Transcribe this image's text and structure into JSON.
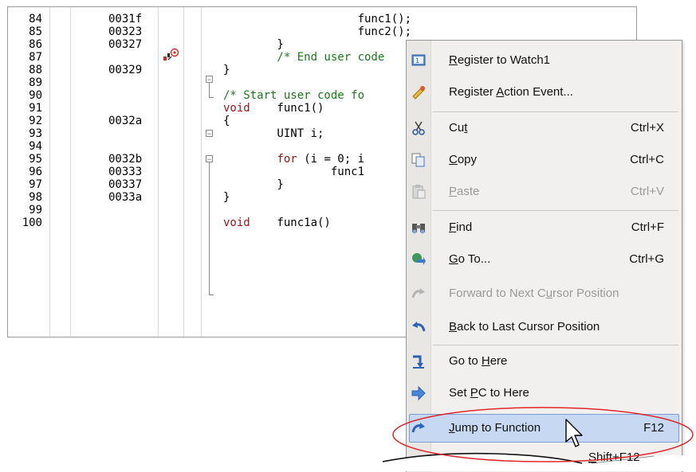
{
  "editor": {
    "lines": [
      {
        "ln": "84",
        "addr": "0031f",
        "src": [
          {
            "t": "                    func1();",
            "c": ""
          }
        ]
      },
      {
        "ln": "85",
        "addr": "00323",
        "src": [
          {
            "t": "                    func2();",
            "c": ""
          }
        ]
      },
      {
        "ln": "86",
        "addr": "00327",
        "src": [
          {
            "t": "        }",
            "c": ""
          }
        ]
      },
      {
        "ln": "87",
        "addr": "",
        "src": [
          {
            "t": "        /* End user code",
            "c": "cm"
          }
        ]
      },
      {
        "ln": "88",
        "addr": "00329",
        "src": [
          {
            "t": "}",
            "c": ""
          }
        ]
      },
      {
        "ln": "89",
        "addr": "",
        "src": []
      },
      {
        "ln": "90",
        "addr": "",
        "src": [
          {
            "t": "/* Start user code fo",
            "c": "cm"
          }
        ]
      },
      {
        "ln": "91",
        "addr": "",
        "src": [
          {
            "t": "void",
            "c": "kw"
          },
          {
            "t": "    func1()",
            "c": ""
          }
        ]
      },
      {
        "ln": "92",
        "addr": "0032a",
        "src": [
          {
            "t": "{",
            "c": ""
          }
        ]
      },
      {
        "ln": "93",
        "addr": "",
        "src": [
          {
            "t": "        UINT i;",
            "c": ""
          }
        ]
      },
      {
        "ln": "94",
        "addr": "",
        "src": []
      },
      {
        "ln": "95",
        "addr": "0032b",
        "src": [
          {
            "t": "        ",
            "c": ""
          },
          {
            "t": "for",
            "c": "kw"
          },
          {
            "t": " (i = 0; i",
            "c": ""
          }
        ]
      },
      {
        "ln": "96",
        "addr": "00333",
        "src": [
          {
            "t": "                func1",
            "c": ""
          }
        ]
      },
      {
        "ln": "97",
        "addr": "00337",
        "src": [
          {
            "t": "        }",
            "c": ""
          }
        ]
      },
      {
        "ln": "98",
        "addr": "0033a",
        "src": [
          {
            "t": "}",
            "c": ""
          }
        ]
      },
      {
        "ln": "99",
        "addr": "",
        "src": []
      },
      {
        "ln": "100",
        "addr": "",
        "src": [
          {
            "t": "void",
            "c": "kw"
          },
          {
            "t": "    func1a()",
            "c": ""
          }
        ]
      }
    ]
  },
  "menu": {
    "items": [
      {
        "id": "register-watch",
        "pre": "",
        "u": "R",
        "post": "egister to Watch1",
        "shortcut": "",
        "icon": "watch-icon",
        "disabled": false
      },
      {
        "id": "register-action",
        "pre": "Register ",
        "u": "A",
        "post": "ction Event...",
        "shortcut": "",
        "icon": "action-event-icon",
        "disabled": false
      },
      {
        "id": "cut",
        "pre": "Cu",
        "u": "t",
        "post": "",
        "shortcut": "Ctrl+X",
        "icon": "scissors-icon",
        "disabled": false
      },
      {
        "id": "copy",
        "pre": "",
        "u": "C",
        "post": "opy",
        "shortcut": "Ctrl+C",
        "icon": "copy-icon",
        "disabled": false
      },
      {
        "id": "paste",
        "pre": "",
        "u": "P",
        "post": "aste",
        "shortcut": "Ctrl+V",
        "icon": "paste-icon",
        "disabled": true
      },
      {
        "id": "find",
        "pre": "",
        "u": "F",
        "post": "ind",
        "shortcut": "Ctrl+F",
        "icon": "binoculars-icon",
        "disabled": false
      },
      {
        "id": "go-to",
        "pre": "",
        "u": "G",
        "post": "o To...",
        "shortcut": "Ctrl+G",
        "icon": "goto-icon",
        "disabled": false
      },
      {
        "id": "forward-cursor",
        "pre": "Forward to Next C",
        "u": "u",
        "post": "rsor Position",
        "shortcut": "",
        "icon": "forward-arrow-icon",
        "disabled": true
      },
      {
        "id": "back-cursor",
        "pre": "",
        "u": "B",
        "post": "ack to Last Cursor Position",
        "shortcut": "",
        "icon": "back-arrow-icon",
        "disabled": false
      },
      {
        "id": "go-to-here",
        "pre": "Go to ",
        "u": "H",
        "post": "ere",
        "shortcut": "",
        "icon": "go-here-icon",
        "disabled": false
      },
      {
        "id": "set-pc",
        "pre": "Set ",
        "u": "P",
        "post": "C to Here",
        "shortcut": "",
        "icon": "set-pc-icon",
        "disabled": false
      },
      {
        "id": "jump-function",
        "pre": "",
        "u": "J",
        "post": "ump to Function",
        "shortcut": "F12",
        "icon": "jump-icon",
        "disabled": false
      }
    ],
    "truncated_item_shortcut_prefix": "S",
    "truncated_item_shortcut_rest": "hift+F12"
  }
}
